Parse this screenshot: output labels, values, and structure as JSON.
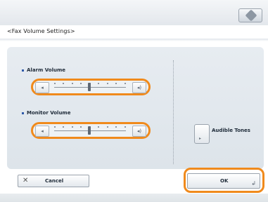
{
  "header": {
    "title": "<Fax Volume Settings>",
    "top_right_icon": "diamond-icon"
  },
  "sections": [
    {
      "label": "Alarm Volume",
      "decrease_icon": "speaker-low-icon",
      "increase_icon": "speaker-high-icon",
      "level_steps": 9,
      "level_value": 4
    },
    {
      "label": "Monitor Volume",
      "decrease_icon": "speaker-low-icon",
      "increase_icon": "speaker-high-icon",
      "level_steps": 9,
      "level_value": 4
    }
  ],
  "audible_tones": {
    "label": "Audible Tones"
  },
  "footer": {
    "cancel_label": "Cancel",
    "ok_label": "OK"
  },
  "colors": {
    "highlight": "#f08a1c",
    "accent_dot": "#2f5aa8"
  }
}
